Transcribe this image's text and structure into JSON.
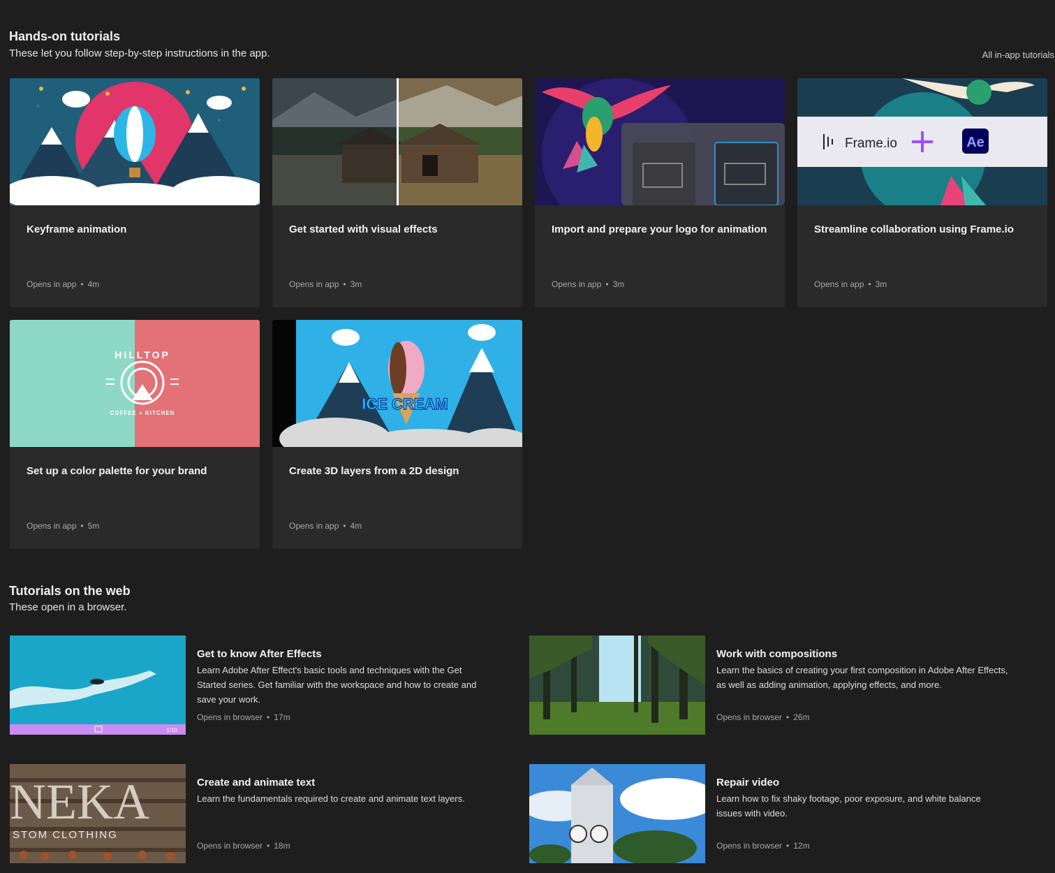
{
  "hands_on": {
    "title": "Hands-on tutorials",
    "subtitle": "These let you follow step-by-step instructions in the app.",
    "all_link": "All in-app tutorials",
    "cards": [
      {
        "title": "Keyframe animation",
        "opens": "Opens in app",
        "duration": "4m",
        "thumb": "balloon-mountains"
      },
      {
        "title": "Get started with visual effects",
        "opens": "Opens in app",
        "duration": "3m",
        "thumb": "cabin-split"
      },
      {
        "title": "Import and prepare your logo for animation",
        "opens": "Opens in app",
        "duration": "3m",
        "thumb": "hummingbird-panels"
      },
      {
        "title": "Streamline collaboration using Frame.io",
        "opens": "Opens in app",
        "duration": "3m",
        "thumb": "frameio-ae",
        "thumb_text": {
          "frameio": "Frame.io",
          "ae": "Ae"
        }
      },
      {
        "title": "Set up a color palette for your brand",
        "opens": "Opens in app",
        "duration": "5m",
        "thumb": "hilltop-logo",
        "thumb_text": {
          "brand": "HILLTOP",
          "tagline": "COFFEE + KITCHEN"
        }
      },
      {
        "title": "Create 3D layers from a 2D design",
        "opens": "Opens in app",
        "duration": "4m",
        "thumb": "ice-cream",
        "thumb_text": {
          "label": "ICE CREAM"
        }
      }
    ]
  },
  "web": {
    "title": "Tutorials on the web",
    "subtitle": "These open in a browser.",
    "items": [
      {
        "title": "Get to know After Effects",
        "desc": "Learn Adobe After Effect's basic tools and techniques with the Get Started series. Get familiar with the workspace and how to create and save your work.",
        "opens": "Opens in browser",
        "duration": "17m",
        "thumb": "jetski-ocean",
        "thumb_text": {
          "counter": "1/10"
        }
      },
      {
        "title": "Work with compositions",
        "desc": "Learn the basics of creating your first composition in Adobe After Effects, as well as adding animation, applying effects, and more.",
        "opens": "Opens in browser",
        "duration": "26m",
        "thumb": "forest-sunlight"
      },
      {
        "title": "Create and animate text",
        "desc": "Learn the fundamentals required to create and animate text layers.",
        "opens": "Opens in browser",
        "duration": "18m",
        "thumb": "text-spools",
        "thumb_text": {
          "big": "NEKA",
          "small": "STOM CLOTHING"
        }
      },
      {
        "title": "Repair video",
        "desc": "Learn how to fix shaky footage, poor exposure, and white balance issues with video.",
        "opens": "Opens in browser",
        "duration": "12m",
        "thumb": "clock-tower"
      }
    ]
  },
  "colors": {
    "background": "#1e1e1e",
    "card": "#2a2a2a",
    "accent_purple": "#9d4dff",
    "ae_blue": "#9999ff"
  }
}
